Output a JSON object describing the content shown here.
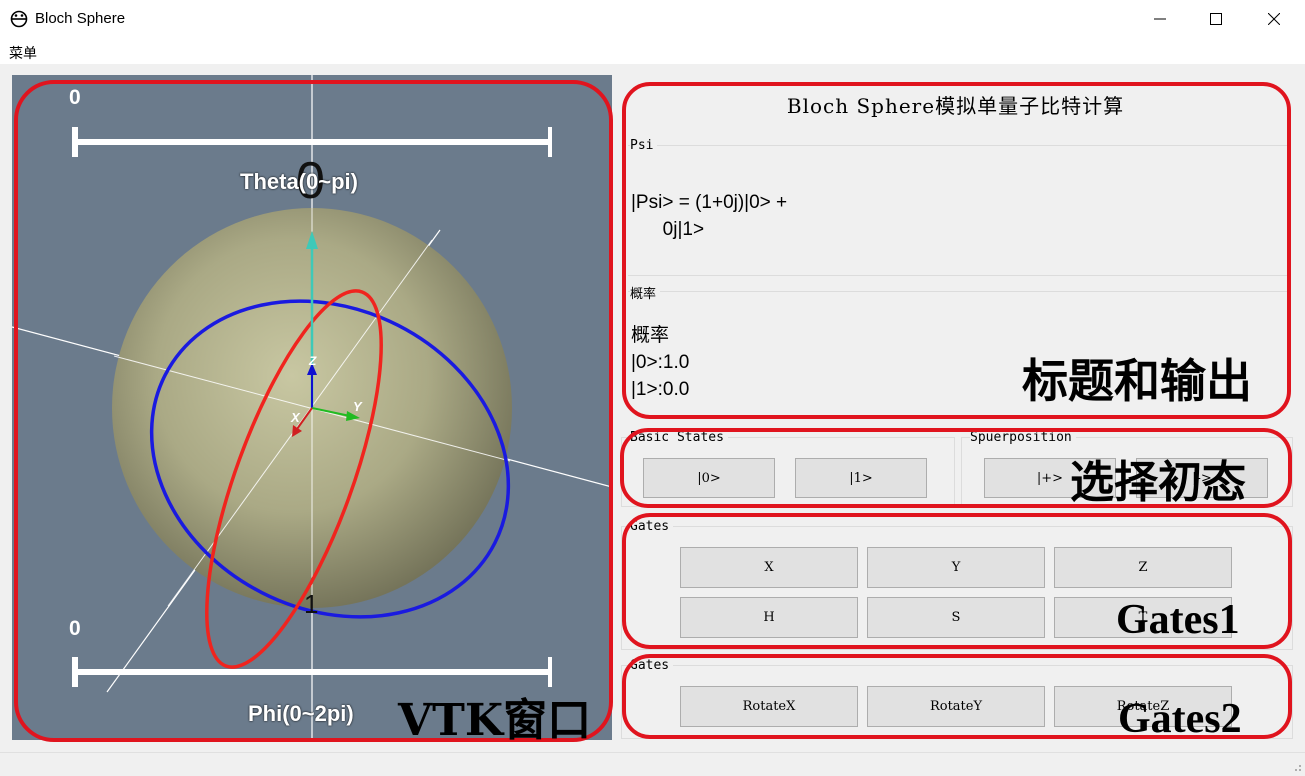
{
  "window": {
    "title": "Bloch Sphere"
  },
  "menu": {
    "items": [
      "菜单"
    ]
  },
  "vtk": {
    "theta_value": "0",
    "theta_label": "Theta(0~pi)",
    "phi_value": "0",
    "phi_label": "Phi(0~2pi)",
    "axis_z": "Z",
    "axis_x": "X",
    "axis_y": "Y",
    "state0_label": "0",
    "state1_label": "1"
  },
  "output": {
    "title": "Bloch Sphere模拟单量子比特计算",
    "psi_group": "Psi",
    "psi_line1": "|Psi> = (1+0j)|0> +",
    "psi_line2": "      0j|1>",
    "prob_group": "概率",
    "prob_line1": "概率",
    "prob_line2": "|0>:1.0",
    "prob_line3": "|1>:0.0"
  },
  "initial_states": {
    "basic_group": "Basic States",
    "btn_0": "|0>",
    "btn_1": "|1>",
    "super_group": "Spuerposition",
    "btn_plus": "|+>",
    "btn_minus": "|->"
  },
  "gates1": {
    "group": "Gates",
    "buttons": [
      "X",
      "Y",
      "Z",
      "H",
      "S",
      "T"
    ]
  },
  "gates2": {
    "group": "Gates",
    "buttons": [
      "RotateX",
      "RotateY",
      "RotateZ"
    ]
  },
  "annotations": {
    "vtk": "VTK窗口",
    "output": "标题和输出",
    "init": "选择初态",
    "gates1": "Gates1",
    "gates2": "Gates2"
  },
  "colors": {
    "annotation_red": "#e0141e",
    "vtk_background": "#6b7b8c",
    "circle_blue": "#1a1ae0",
    "circle_red": "#f0241e"
  }
}
